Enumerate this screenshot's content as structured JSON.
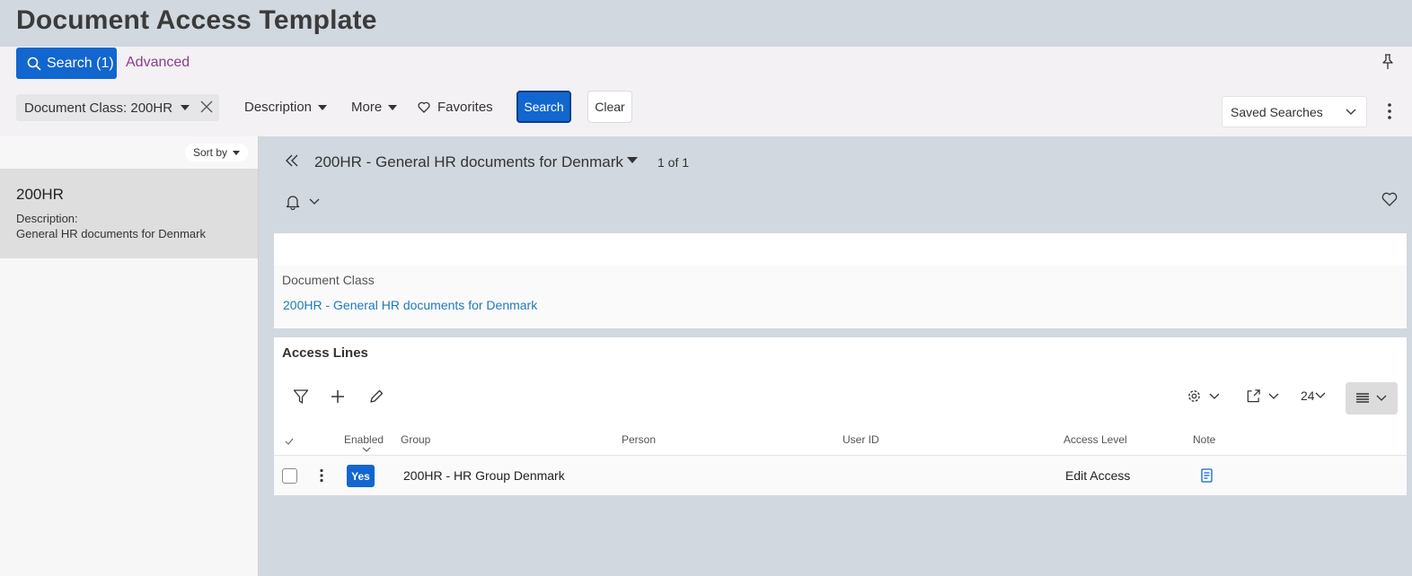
{
  "page": {
    "title": "Document Access Template"
  },
  "search": {
    "search_count_label": "Search (1)",
    "advanced_label": "Advanced",
    "chip_label": "Document Class: 200HR",
    "description_label": "Description",
    "more_label": "More",
    "favorites_label": "Favorites",
    "search_button": "Search",
    "clear_button": "Clear",
    "saved_searches_label": "Saved Searches"
  },
  "list": {
    "sort_label": "Sort by",
    "items": [
      {
        "id": "200HR",
        "desc_label": "Description:",
        "desc": "General HR documents for Denmark"
      }
    ]
  },
  "record": {
    "title": "200HR - General HR documents for Denmark",
    "pager": "1 of 1",
    "doc_class_label": "Document Class",
    "doc_class_value": "200HR - General HR documents for Denmark"
  },
  "access_lines": {
    "title": "Access Lines",
    "page_size": "24",
    "columns": {
      "enabled": "Enabled",
      "group": "Group",
      "person": "Person",
      "user_id": "User ID",
      "access_level": "Access Level",
      "note": "Note"
    },
    "rows": [
      {
        "enabled": "Yes",
        "group": "200HR - HR Group Denmark",
        "person": "",
        "user_id": "",
        "access_level": "Edit Access"
      }
    ]
  },
  "colors": {
    "accent": "#1266cf",
    "link": "#1f7ab8",
    "advanced": "#8a3d8f",
    "background": "#d1d8df"
  }
}
